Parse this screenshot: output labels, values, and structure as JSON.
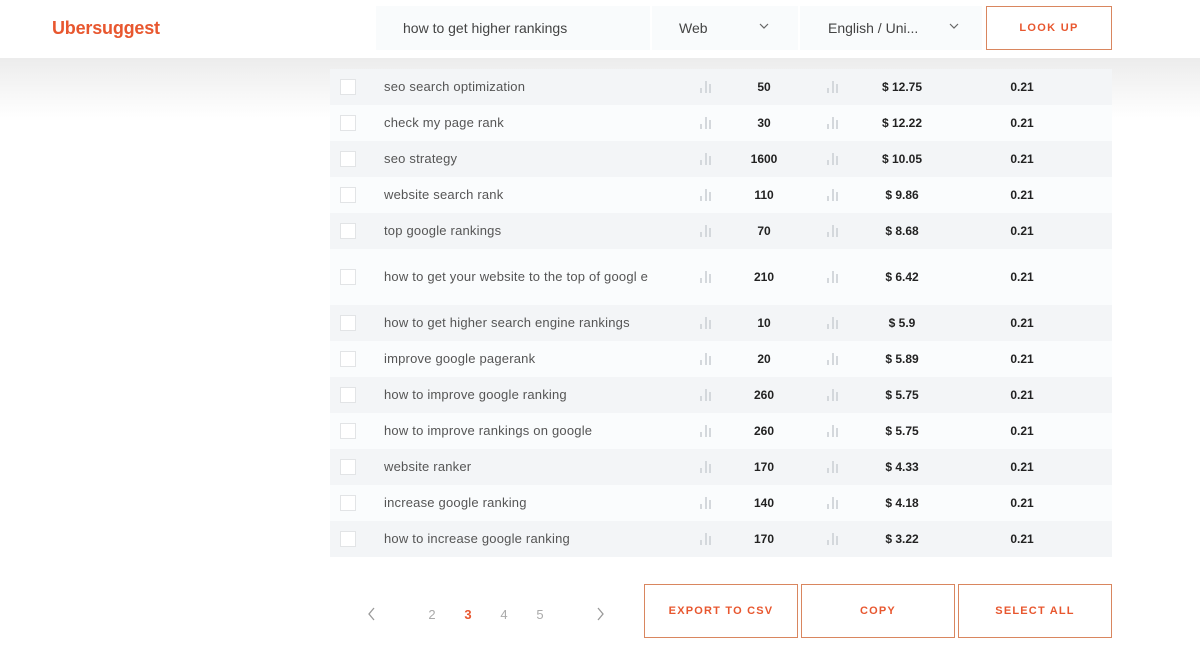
{
  "app": {
    "logo": "Ubersuggest"
  },
  "search": {
    "query": "how to get higher rankings",
    "source_select": "Web",
    "language_select": "English / Uni...",
    "lookup_label": "LOOK UP"
  },
  "table": {
    "rows": [
      {
        "keyword": "seo search optimization",
        "volume": "50",
        "cpc": "$ 12.75",
        "competition": "0.21"
      },
      {
        "keyword": "check my page rank",
        "volume": "30",
        "cpc": "$ 12.22",
        "competition": "0.21"
      },
      {
        "keyword": "seo strategy",
        "volume": "1600",
        "cpc": "$ 10.05",
        "competition": "0.21"
      },
      {
        "keyword": "website search rank",
        "volume": "110",
        "cpc": "$ 9.86",
        "competition": "0.21"
      },
      {
        "keyword": "top google rankings",
        "volume": "70",
        "cpc": "$ 8.68",
        "competition": "0.21"
      },
      {
        "keyword": "how to get your website to the top of googl e",
        "volume": "210",
        "cpc": "$ 6.42",
        "competition": "0.21"
      },
      {
        "keyword": "how to get higher search engine rankings",
        "volume": "10",
        "cpc": "$ 5.9",
        "competition": "0.21"
      },
      {
        "keyword": "improve google pagerank",
        "volume": "20",
        "cpc": "$ 5.89",
        "competition": "0.21"
      },
      {
        "keyword": "how to improve google ranking",
        "volume": "260",
        "cpc": "$ 5.75",
        "competition": "0.21"
      },
      {
        "keyword": "how to improve rankings on google",
        "volume": "260",
        "cpc": "$ 5.75",
        "competition": "0.21"
      },
      {
        "keyword": "website ranker",
        "volume": "170",
        "cpc": "$ 4.33",
        "competition": "0.21"
      },
      {
        "keyword": "increase google ranking",
        "volume": "140",
        "cpc": "$ 4.18",
        "competition": "0.21"
      },
      {
        "keyword": "how to increase google ranking",
        "volume": "170",
        "cpc": "$ 3.22",
        "competition": "0.21"
      }
    ]
  },
  "pagination": {
    "pages": [
      "2",
      "3",
      "4",
      "5"
    ],
    "current": "3",
    "prev_icon": "chevron-left-icon",
    "next_icon": "chevron-right-icon"
  },
  "actions": {
    "export_label": "EXPORT TO CSV",
    "copy_label": "COPY",
    "select_all_label": "SELECT ALL"
  },
  "colors": {
    "accent": "#e8572f",
    "button_border": "#d9865f"
  }
}
